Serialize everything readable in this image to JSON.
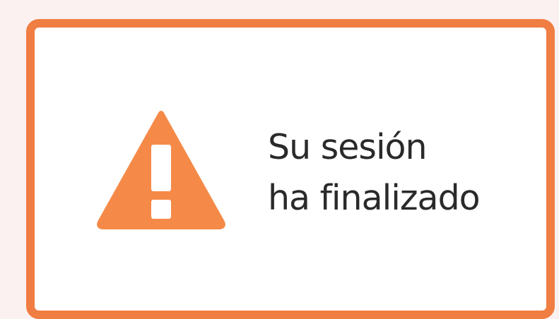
{
  "alert": {
    "icon": "warning-icon",
    "message_lines": [
      "Su sesión",
      "ha finalizado"
    ]
  },
  "colors": {
    "accent": "#f07d41",
    "page_background": "#fcf1f1",
    "card_background": "#ffffff",
    "text": "#2a2a2a",
    "icon_fill": "#f58a48"
  }
}
